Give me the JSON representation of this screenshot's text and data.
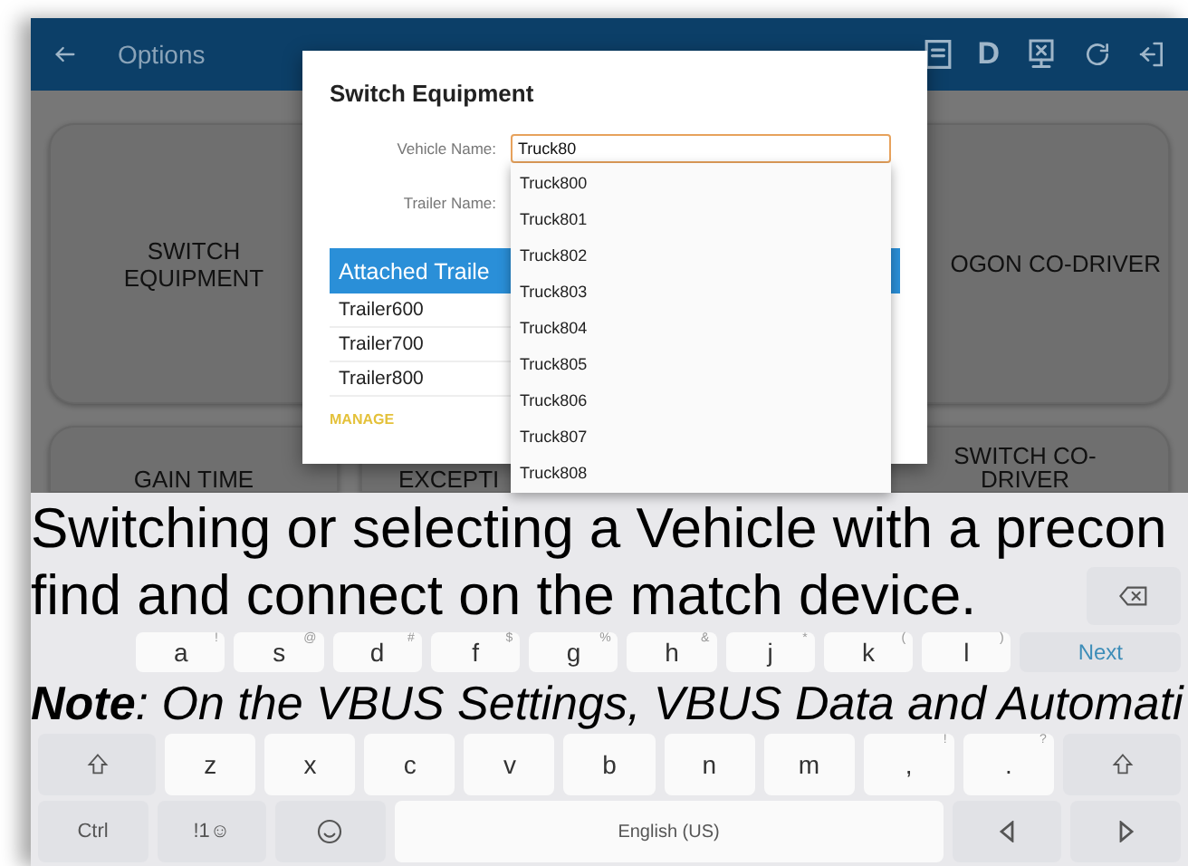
{
  "top_bar": {
    "title": "Options",
    "letter_icon": "D"
  },
  "tiles": [
    {
      "label": "SWITCH EQUIPMENT"
    },
    {
      "label": "OGON CO-DRIVER"
    },
    {
      "label": "GAIN TIME"
    },
    {
      "label": "EXCEPTI"
    },
    {
      "label": "SWITCH CO-DRIVER"
    }
  ],
  "dialog": {
    "title": "Switch Equipment",
    "vehicle_label": "Vehicle Name:",
    "vehicle_value": "Truck80",
    "trailer_label": "Trailer Name:",
    "attached_header": "Attached Traile",
    "trailers": [
      "Trailer600",
      "Trailer700",
      "Trailer800"
    ],
    "manage": "MANAGE"
  },
  "suggestions": [
    "Truck800",
    "Truck801",
    "Truck802",
    "Truck803",
    "Truck804",
    "Truck805",
    "Truck806",
    "Truck807",
    "Truck808"
  ],
  "keyboard": {
    "row_a": [
      {
        "label": "a",
        "hint": "!"
      },
      {
        "label": "s",
        "hint": "@"
      },
      {
        "label": "d",
        "hint": "#"
      },
      {
        "label": "f",
        "hint": "$"
      },
      {
        "label": "g",
        "hint": "%"
      },
      {
        "label": "h",
        "hint": "&"
      },
      {
        "label": "j",
        "hint": "*"
      },
      {
        "label": "k",
        "hint": "("
      },
      {
        "label": "l",
        "hint": ")"
      }
    ],
    "next": "Next",
    "row_z": [
      {
        "label": "z"
      },
      {
        "label": "x"
      },
      {
        "label": "c"
      },
      {
        "label": "v"
      },
      {
        "label": "b"
      },
      {
        "label": "n"
      },
      {
        "label": "m"
      },
      {
        "label": ",",
        "hint": "!"
      },
      {
        "label": ".",
        "hint": "?"
      }
    ],
    "ctrl": "Ctrl",
    "symbols": "!1☺",
    "space": "English (US)"
  },
  "overlay": {
    "line_1": "Switching or selecting a Vehicle with a precon",
    "line_2": "find and connect on the match device.",
    "note": "**Note**: On the VBUS Settings, VBUS Data and Automati"
  }
}
